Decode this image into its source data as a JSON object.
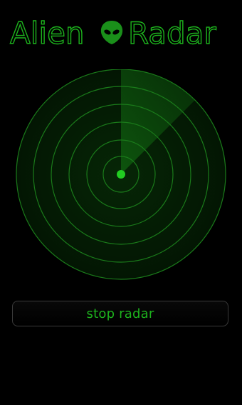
{
  "app": {
    "title_word_1": "Alien",
    "title_word_2": "Radar",
    "logo_icon": "alien-head-icon"
  },
  "radar": {
    "ring_count": 6,
    "sweep_angle_deg": 45
  },
  "controls": {
    "stop_label": "stop radar"
  },
  "colors": {
    "background": "#000000",
    "accent": "#1db31d",
    "ring": "#1a7a1a",
    "sweep": "#0c4a0c",
    "center_dot": "#22cc22",
    "button_border": "#3a3a3a"
  }
}
